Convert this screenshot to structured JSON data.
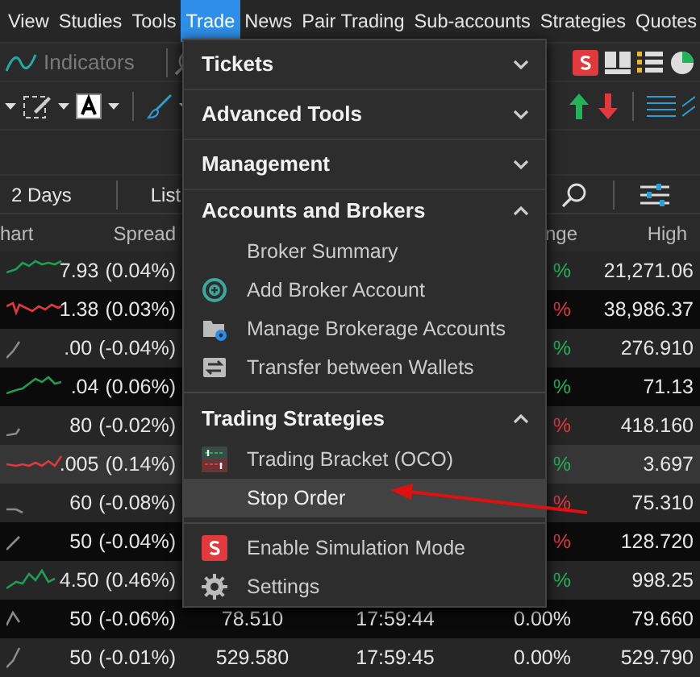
{
  "menu_bar": [
    {
      "label": "View",
      "selected": false
    },
    {
      "label": "Studies",
      "selected": false
    },
    {
      "label": "Tools",
      "selected": false
    },
    {
      "label": "Trade",
      "selected": true
    },
    {
      "label": "News",
      "selected": false
    },
    {
      "label": "Pair Trading",
      "selected": false
    },
    {
      "label": "Sub-accounts",
      "selected": false
    },
    {
      "label": "Strategies",
      "selected": false
    },
    {
      "label": "Quotes",
      "selected": false
    }
  ],
  "toolbar": {
    "indicators_label": "Indicators"
  },
  "view_tabs": [
    {
      "label": "2 Days"
    },
    {
      "label": "List"
    }
  ],
  "table": {
    "columns": [
      "hart",
      "Spread",
      "nge",
      "High"
    ],
    "rows": [
      {
        "sparkline": {
          "color": "#1f9d55"
        },
        "price": "7.93",
        "spread": "(0.04%)",
        "change": {
          "text": "%",
          "color": "#22b35a"
        },
        "high": "21,271.06",
        "highlighted": false
      },
      {
        "sparkline": {
          "color": "#e0393e"
        },
        "price": "1.38",
        "spread": "(0.03%)",
        "change": {
          "text": "%",
          "color": "#e0393e"
        },
        "high": "38,986.37",
        "highlighted": false
      },
      {
        "sparkline": {
          "color": "#8a8a8a"
        },
        "price": ".00",
        "spread": "(-0.04%)",
        "change": {
          "text": "%",
          "color": "#22b35a"
        },
        "high": "276.910",
        "highlighted": false
      },
      {
        "sparkline": {
          "color": "#1f9d55"
        },
        "price": ".04",
        "spread": "(0.06%)",
        "change": {
          "text": "%",
          "color": "#22b35a"
        },
        "high": "71.13",
        "highlighted": false
      },
      {
        "sparkline": {
          "color": "#8a8a8a"
        },
        "price": "80",
        "spread": "(-0.02%)",
        "change": {
          "text": "%",
          "color": "#e0393e"
        },
        "high": "418.160",
        "highlighted": false
      },
      {
        "sparkline": {
          "color": "#e0393e"
        },
        "price": ".005",
        "spread": "(0.14%)",
        "change": {
          "text": "%",
          "color": "#22b35a"
        },
        "high": "3.697",
        "highlighted": true
      },
      {
        "sparkline": {
          "color": "#8a8a8a"
        },
        "price": "60",
        "spread": "(-0.08%)",
        "change": {
          "text": "%",
          "color": "#e0393e"
        },
        "high": "75.310",
        "highlighted": false
      },
      {
        "sparkline": {
          "color": "#8a8a8a"
        },
        "price": "50",
        "spread": "(-0.04%)",
        "change": {
          "text": "%",
          "color": "#e0393e"
        },
        "high": "128.720",
        "highlighted": false
      },
      {
        "sparkline": {
          "color": "#1f9d55"
        },
        "price": "4.50",
        "spread": "(0.46%)",
        "change": {
          "text": "%",
          "color": "#22b35a"
        },
        "high": "998.25",
        "highlighted": false
      },
      {
        "sparkline": {
          "color": "#8a8a8a"
        },
        "price": "50",
        "spread": "(-0.06%)",
        "last": "78.510",
        "time": "17:59:44",
        "change": {
          "text": "0.00%",
          "color": "#e6e6e6"
        },
        "high": "79.660",
        "highlighted": false
      },
      {
        "sparkline": {
          "color": "#8a8a8a"
        },
        "price": "50",
        "spread": "(-0.01%)",
        "last": "529.580",
        "time": "17:59:45",
        "change": {
          "text": "0.00%",
          "color": "#e6e6e6"
        },
        "high": "529.790",
        "highlighted": false
      }
    ]
  },
  "menu": {
    "sections": [
      {
        "title": "Tickets",
        "expanded": false
      },
      {
        "title": "Advanced Tools",
        "expanded": false
      },
      {
        "title": "Management",
        "expanded": false
      },
      {
        "title": "Accounts and Brokers",
        "expanded": true,
        "items": [
          {
            "label": "Broker Summary",
            "kind": "plain",
            "highlighted": false
          },
          {
            "label": "Add Broker Account",
            "kind": "add",
            "highlighted": false
          },
          {
            "label": "Manage Brokerage Accounts",
            "kind": "manage",
            "highlighted": false
          },
          {
            "label": "Transfer between Wallets",
            "kind": "transfer",
            "highlighted": false
          }
        ]
      },
      {
        "title": "Trading Strategies",
        "expanded": true,
        "items": [
          {
            "label": "Trading Bracket (OCO)",
            "kind": "bracket",
            "highlighted": false
          },
          {
            "label": "Stop Order",
            "kind": "plain",
            "highlighted": true
          }
        ]
      }
    ],
    "footer_items": [
      {
        "label": "Enable Simulation Mode",
        "kind": "simulation"
      },
      {
        "label": "Settings",
        "kind": "gear"
      }
    ]
  }
}
